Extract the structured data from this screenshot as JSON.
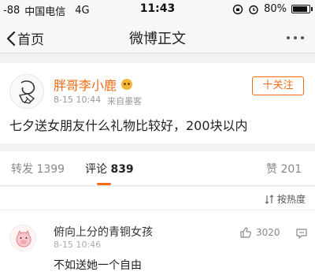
{
  "status_bar": {
    "signal": "-88",
    "carrier": "中国电信",
    "network": "4G",
    "time": "11:43",
    "battery": "80%",
    "battery_level": 0.8
  },
  "nav": {
    "back_label": "首页",
    "title": "微博正文"
  },
  "post": {
    "author": "胖哥李小鹿",
    "timestamp": "8-15 10:44",
    "source": "来自墨客",
    "follow_label": "十关注",
    "text": "七夕送女朋友什么礼物比较好，200块以内"
  },
  "stats": {
    "repost_label": "转发",
    "repost_count": "1399",
    "comment_label": "评论",
    "comment_count": "839",
    "like_label": "赞",
    "like_count": "201"
  },
  "sort": {
    "label": "按热度"
  },
  "comment": {
    "author": "俯向上分的青铜女孩",
    "timestamp": "8-15 10:46",
    "text": "不如送她一个自由",
    "likes": "3020"
  },
  "colors": {
    "accent": "#f36b16",
    "background": "#f2f2f2"
  }
}
